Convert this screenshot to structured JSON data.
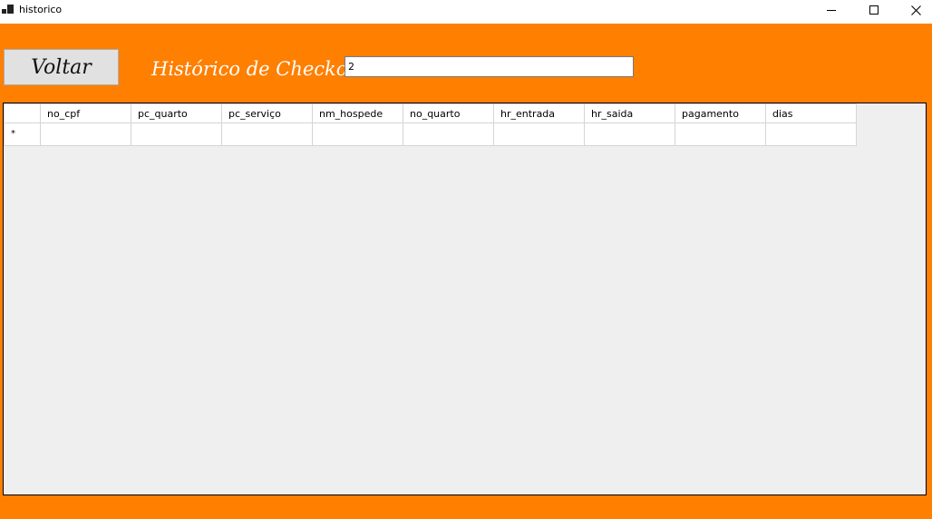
{
  "window": {
    "title": "historico",
    "icon": "app-window-icon"
  },
  "toolbar": {
    "back_label": "Voltar",
    "history_label": "Histórico de Checkouts:",
    "count_value": "2"
  },
  "grid": {
    "columns": [
      "no_cpf",
      "pc_quarto",
      "pc_serviço",
      "nm_hospede",
      "no_quarto",
      "hr_entrada",
      "hr_saida",
      "pagamento",
      "dias"
    ],
    "new_row_marker": "*"
  },
  "colors": {
    "background": "#ff7f00",
    "grid_background": "#efefef"
  }
}
